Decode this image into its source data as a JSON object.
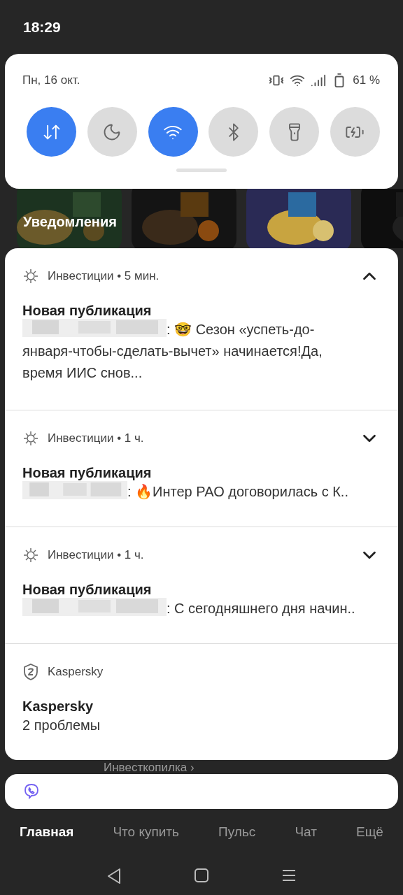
{
  "status_bar": {
    "time": "18:29"
  },
  "quick_panel": {
    "date": "Пн, 16 окт.",
    "battery": "61 %",
    "toggles": [
      {
        "kind": "data",
        "on": true
      },
      {
        "kind": "moon",
        "on": false
      },
      {
        "kind": "wifi",
        "on": true
      },
      {
        "kind": "bluetooth",
        "on": false
      },
      {
        "kind": "flashlight",
        "on": false
      },
      {
        "kind": "battery",
        "on": false
      }
    ]
  },
  "background_app": {
    "heading": "Уведомления",
    "link": "Инвесткопилка ›",
    "nav": [
      {
        "label": "Главная",
        "selected": true
      },
      {
        "label": "Что купить",
        "selected": false
      },
      {
        "label": "Пульс",
        "selected": false
      },
      {
        "label": "Чат",
        "selected": false
      },
      {
        "label": "Ещё",
        "selected": false
      }
    ]
  },
  "notifications": [
    {
      "kind": "investments",
      "header": "Инвестиции • 5 мин.",
      "expanded": true,
      "title": "Новая публикация",
      "redacted": true,
      "body": ": 🤓 Сезон «успеть-до-января-чтобы-сделать-вычет» начинается!Да, время ИИС снов..."
    },
    {
      "kind": "investments",
      "header": "Инвестиции • 1 ч.",
      "expanded": false,
      "title": "Новая публикация",
      "redacted": true,
      "body": ": 🔥Интер РАО договорилась с К.."
    },
    {
      "kind": "investments",
      "header": "Инвестиции • 1 ч.",
      "expanded": false,
      "title": "Новая публикация",
      "redacted": true,
      "body": ": С сегодняшнего дня начин.."
    },
    {
      "kind": "security",
      "header": "Kaspersky",
      "title": "Kaspersky",
      "redacted": false,
      "body": "2 проблемы"
    }
  ]
}
